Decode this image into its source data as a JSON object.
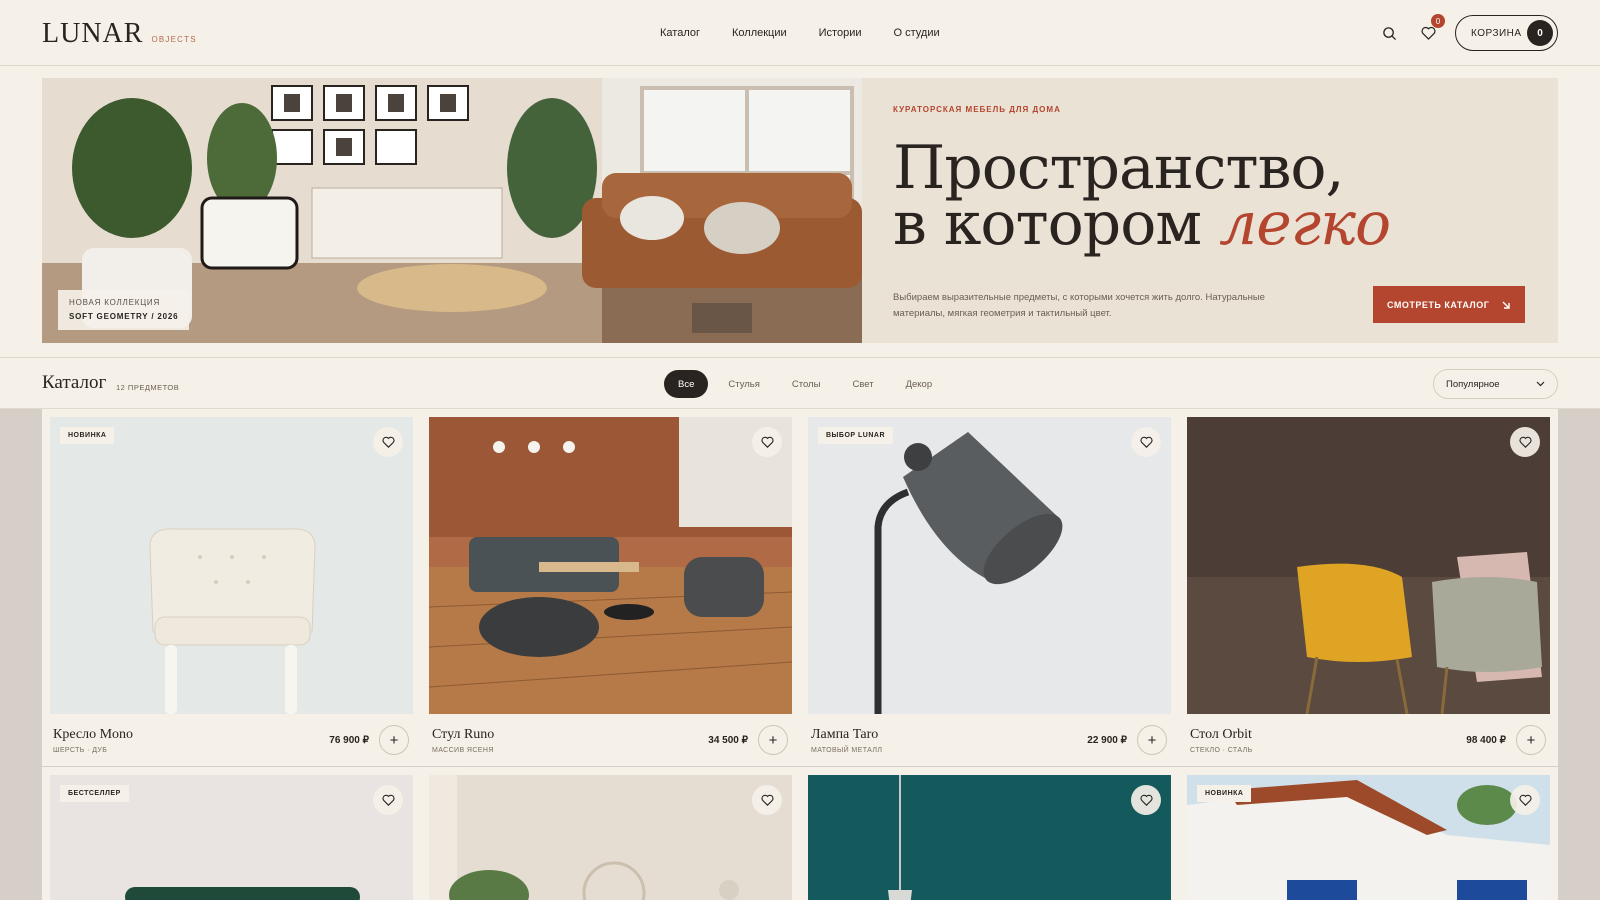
{
  "header": {
    "logo": "LUNAR",
    "logo_sub": "OBJECTS",
    "nav": [
      "Каталог",
      "Коллекции",
      "Истории",
      "О студии"
    ],
    "favorites_count": "0",
    "cart_label": "КОРЗИНА",
    "cart_count": "0"
  },
  "hero": {
    "eyebrow": "КУРАТОРСКАЯ МЕБЕЛЬ ДЛЯ ДОМА",
    "headline_line1": "Пространство,",
    "headline_line2": "в котором",
    "headline_accent": "легко",
    "lead": "Выбираем выразительные предметы, с которыми хочется жить долго. Натуральные материалы, мягкая геометрия и тактильный цвет.",
    "cta": "СМОТРЕТЬ КАТАЛОГ",
    "tag_line1": "НОВАЯ КОЛЛЕКЦИЯ",
    "tag_line2": "SOFT GEOMETRY / 2026"
  },
  "catalog": {
    "title": "Каталог",
    "count": "12 ПРЕДМЕТОВ",
    "filters": [
      "Все",
      "Стулья",
      "Столы",
      "Свет",
      "Декор"
    ],
    "active_filter": "Все",
    "sort": "Популярное"
  },
  "products": [
    {
      "badge": "НОВИНКА",
      "name": "Кресло Mono",
      "material": "ШЕРСТЬ · ДУБ",
      "price": "76 900 ₽"
    },
    {
      "badge": "",
      "name": "Стул Runo",
      "material": "МАССИВ ЯСЕНЯ",
      "price": "34 500 ₽"
    },
    {
      "badge": "ВЫБОР LUNAR",
      "name": "Лампа Taro",
      "material": "МАТОВЫЙ МЕТАЛЛ",
      "price": "22 900 ₽"
    },
    {
      "badge": "",
      "name": "Стол Orbit",
      "material": "СТЕКЛО · СТАЛЬ",
      "price": "98 400 ₽"
    },
    {
      "badge": "БЕСТСЕЛЛЕР"
    },
    {
      "badge": ""
    },
    {
      "badge": ""
    },
    {
      "badge": "НОВИНКА"
    }
  ],
  "colors": {
    "accent": "#b4452e",
    "ink": "#2a2420",
    "paper": "#f5f0e8"
  }
}
